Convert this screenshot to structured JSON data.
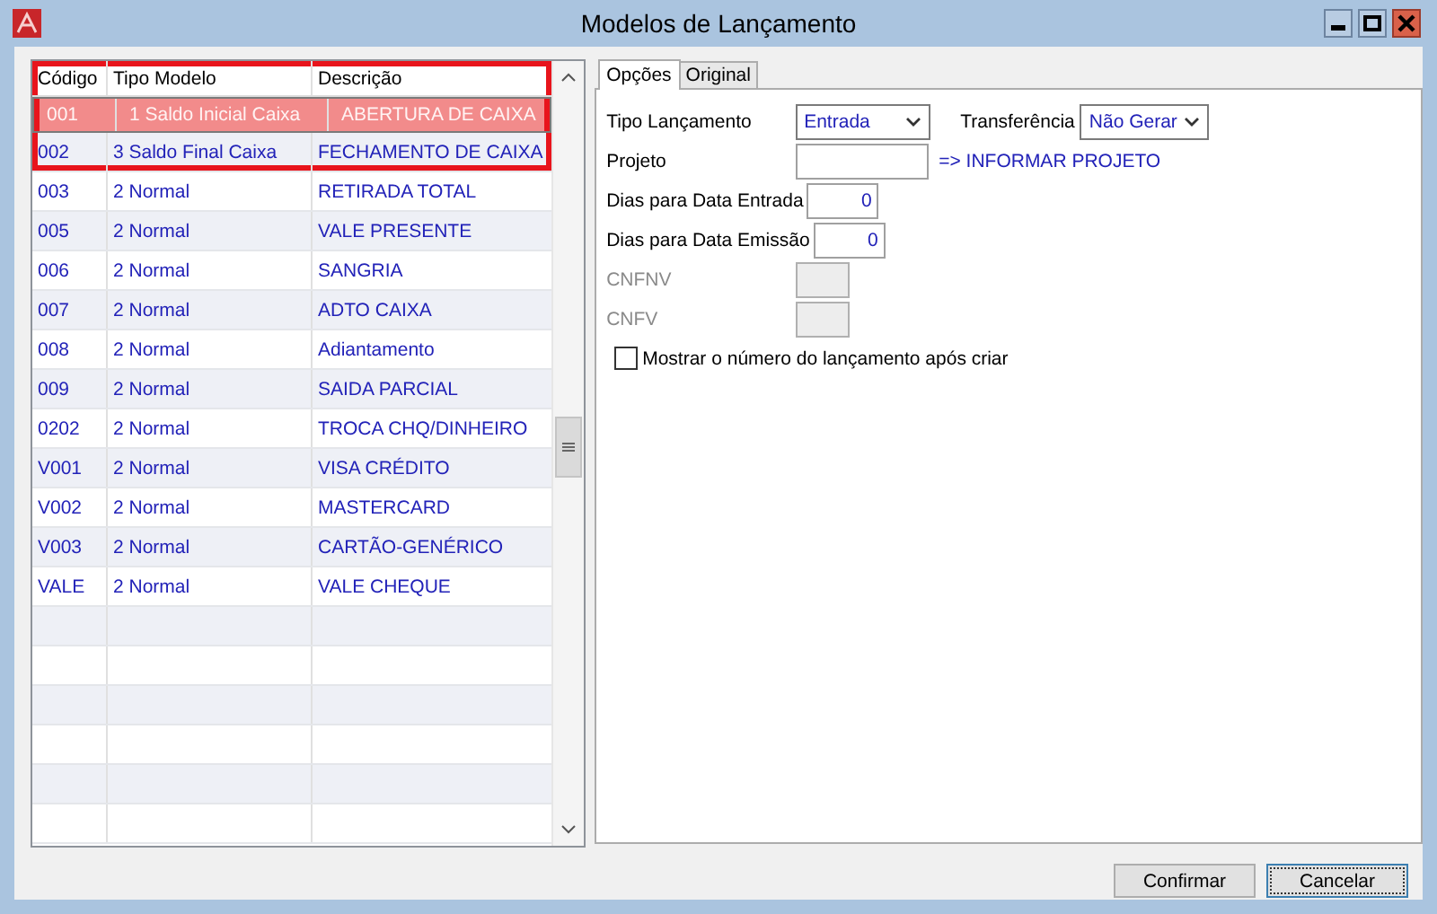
{
  "window": {
    "title": "Modelos de Lançamento"
  },
  "grid": {
    "columns": [
      "Código",
      "Tipo Modelo",
      "Descrição"
    ],
    "rows": [
      {
        "code": "001",
        "type": "1 Saldo Inicial Caixa",
        "description": "ABERTURA DE CAIXA",
        "selected": true,
        "highlighted": true
      },
      {
        "code": "002",
        "type": "3 Saldo Final Caixa",
        "description": "FECHAMENTO DE CAIXA",
        "selected": false,
        "highlighted": true
      },
      {
        "code": "003",
        "type": "2 Normal",
        "description": "RETIRADA TOTAL",
        "selected": false,
        "highlighted": false
      },
      {
        "code": "005",
        "type": "2 Normal",
        "description": "VALE PRESENTE",
        "selected": false,
        "highlighted": false
      },
      {
        "code": "006",
        "type": "2 Normal",
        "description": "SANGRIA",
        "selected": false,
        "highlighted": false
      },
      {
        "code": "007",
        "type": "2 Normal",
        "description": "ADTO CAIXA",
        "selected": false,
        "highlighted": false
      },
      {
        "code": "008",
        "type": "2 Normal",
        "description": "Adiantamento",
        "selected": false,
        "highlighted": false
      },
      {
        "code": "009",
        "type": "2 Normal",
        "description": "SAIDA PARCIAL",
        "selected": false,
        "highlighted": false
      },
      {
        "code": "0202",
        "type": "2 Normal",
        "description": "TROCA CHQ/DINHEIRO",
        "selected": false,
        "highlighted": false
      },
      {
        "code": "V001",
        "type": "2 Normal",
        "description": "VISA CRÉDITO",
        "selected": false,
        "highlighted": false
      },
      {
        "code": "V002",
        "type": "2 Normal",
        "description": "MASTERCARD",
        "selected": false,
        "highlighted": false
      },
      {
        "code": "V003",
        "type": "2 Normal",
        "description": "CARTÃO-GENÉRICO",
        "selected": false,
        "highlighted": false
      },
      {
        "code": "VALE",
        "type": "2 Normal",
        "description": "VALE CHEQUE",
        "selected": false,
        "highlighted": false
      }
    ]
  },
  "tabs": [
    {
      "label": "Opções",
      "selected": true
    },
    {
      "label": "Original",
      "selected": false
    }
  ],
  "form": {
    "tipo_lancamento": {
      "label": "Tipo Lançamento",
      "value": "Entrada"
    },
    "transferencia": {
      "label": "Transferência",
      "value": "Não Gerar"
    },
    "projeto": {
      "label": "Projeto",
      "hint": "=> INFORMAR PROJETO"
    },
    "fields": [
      {
        "kind": "number",
        "label": "Dias para Data Entrada",
        "value": "0",
        "disabled": false
      },
      {
        "kind": "number",
        "label": "Dias para Data Emissão",
        "value": "0",
        "disabled": false
      },
      {
        "kind": "text",
        "label": "CNFNV",
        "disabled": true
      },
      {
        "kind": "text",
        "label": "CNFV",
        "disabled": true
      }
    ],
    "checkbox": {
      "label": "Mostrar o número do lançamento após criar",
      "checked": false
    }
  },
  "buttons": [
    "Confirmar",
    "Cancelar"
  ]
}
